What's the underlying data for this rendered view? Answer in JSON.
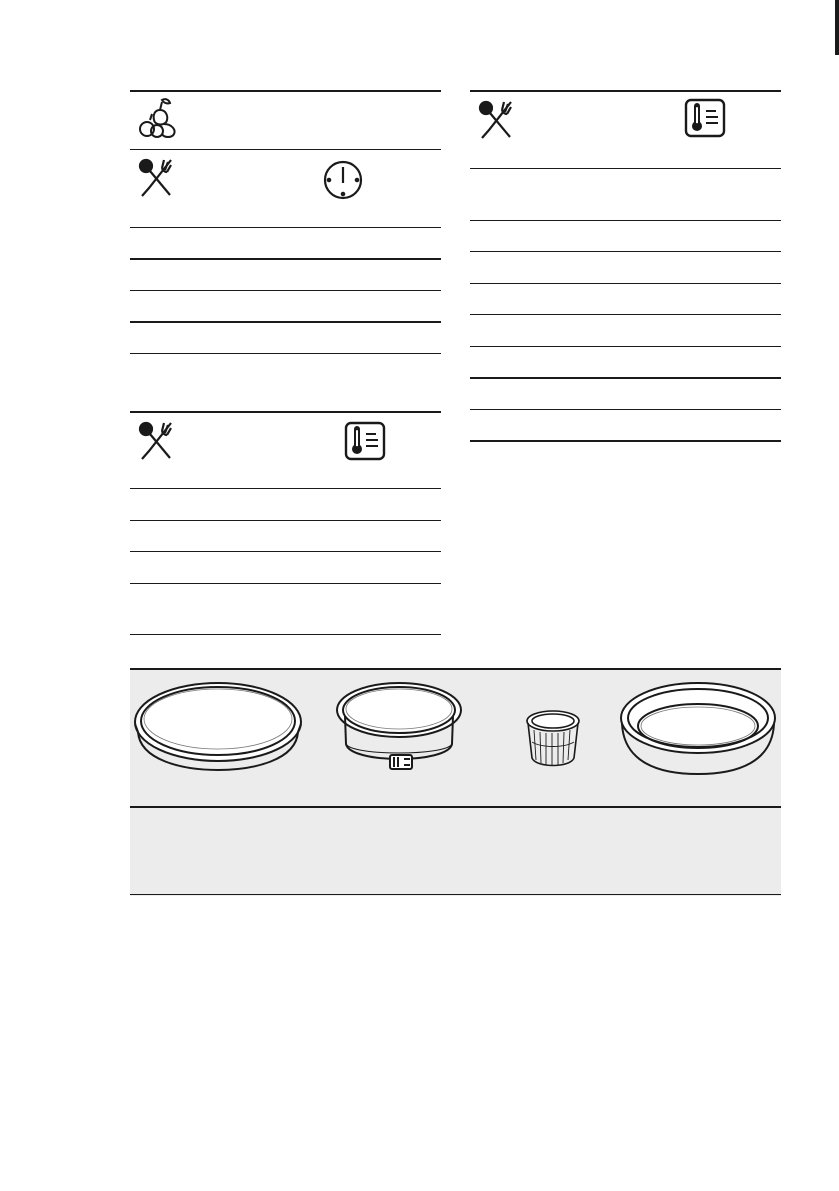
{
  "table_fruit": {
    "header_icons": [
      "fruit-icon"
    ],
    "subheader_icons": [
      "cutlery-icon",
      "clock-icon"
    ],
    "rows": [
      "",
      "",
      "",
      ""
    ]
  },
  "table_meat_left": {
    "header_icons": [
      "cutlery-icon",
      "food-sensor-thermometer-icon"
    ],
    "rows": [
      "",
      "",
      "",
      ""
    ]
  },
  "table_meat_right": {
    "header_icons": [
      "cutlery-icon",
      "food-sensor-thermometer-icon"
    ],
    "rows": [
      "",
      "",
      "",
      "",
      "",
      "",
      "",
      ""
    ]
  },
  "cookware": {
    "items": [
      "flan-tin-icon",
      "springform-tin-icon",
      "ramekin-icon",
      "pie-dish-icon"
    ],
    "caption_rows": [
      ""
    ]
  },
  "colors": {
    "rule": "#1a1a1a",
    "panel_fill": "#ececed",
    "icon_stroke": "#1a1a1a"
  }
}
